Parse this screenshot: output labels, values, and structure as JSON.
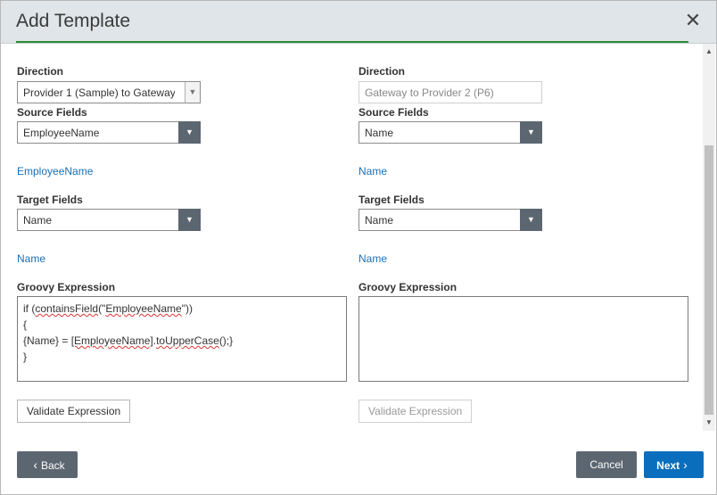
{
  "dialog": {
    "title": "Add Template",
    "close_glyph": "✕"
  },
  "left": {
    "direction_label": "Direction",
    "direction_value": "Provider 1 (Sample) to Gateway",
    "source_label": "Source Fields",
    "source_value": "EmployeeName",
    "source_link": "EmployeeName",
    "target_label": "Target Fields",
    "target_value": "Name",
    "target_link": "Name",
    "groovy_label": "Groovy Expression",
    "groovy_lines": [
      "if (containsField(\"EmployeeName\"))",
      "{",
      "{Name} = [EmployeeName].toUpperCase();}",
      "}"
    ],
    "validate_label": "Validate Expression"
  },
  "right": {
    "direction_label": "Direction",
    "direction_value": "Gateway to Provider 2 (P6)",
    "source_label": "Source Fields",
    "source_value": "Name",
    "source_link": "Name",
    "target_label": "Target Fields",
    "target_value": "Name",
    "target_link": "Name",
    "groovy_label": "Groovy Expression",
    "groovy_value": "",
    "validate_label": "Validate Expression"
  },
  "footer": {
    "back_label": "Back",
    "cancel_label": "Cancel",
    "next_label": "Next"
  },
  "colors": {
    "accent_blue": "#0a6ebd",
    "dark_button": "#5c6670",
    "link_blue": "#1a6fb5",
    "success_line": "#2e8b2e"
  },
  "icons": {
    "close": "close-icon",
    "dropdown": "chevron-down-icon",
    "back": "chevron-left-icon",
    "next": "chevron-right-icon"
  }
}
